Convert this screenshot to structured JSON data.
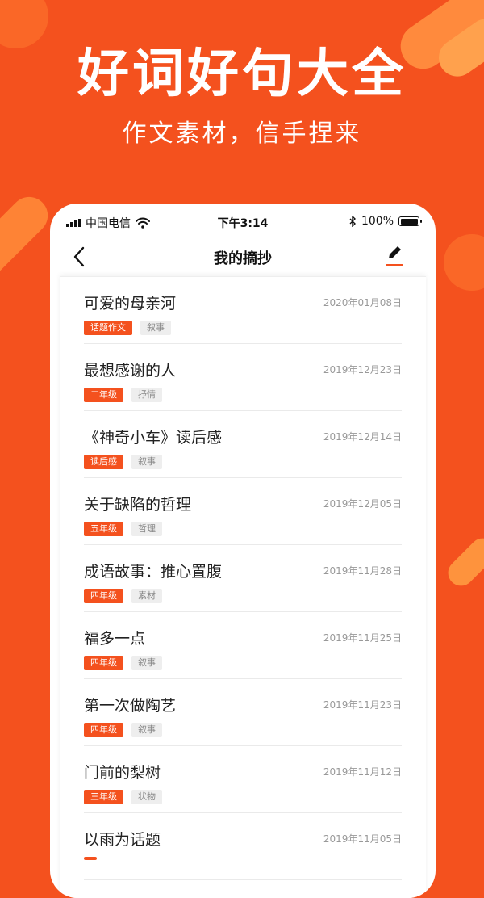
{
  "hero": {
    "title": "好词好句大全",
    "subtitle": "作文素材，信手捏来"
  },
  "status_bar": {
    "carrier": "中国电信",
    "time": "下午3:14",
    "battery": "100%"
  },
  "nav": {
    "title": "我的摘抄",
    "back_icon": "chevron-left-icon",
    "edit_icon": "pencil-icon"
  },
  "colors": {
    "accent": "#f4511e",
    "tag_secondary_bg": "#eeeeee"
  },
  "items": [
    {
      "title": "可爱的母亲河",
      "date": "2020年01月08日",
      "tag1": "话题作文",
      "tag2": "叙事"
    },
    {
      "title": "最想感谢的人",
      "date": "2019年12月23日",
      "tag1": "二年级",
      "tag2": "抒情"
    },
    {
      "title": "《神奇小车》读后感",
      "date": "2019年12月14日",
      "tag1": "读后感",
      "tag2": "叙事"
    },
    {
      "title": "关于缺陷的哲理",
      "date": "2019年12月05日",
      "tag1": "五年级",
      "tag2": "哲理"
    },
    {
      "title": "成语故事：推心置腹",
      "date": "2019年11月28日",
      "tag1": "四年级",
      "tag2": "素材"
    },
    {
      "title": "福多一点",
      "date": "2019年11月25日",
      "tag1": "四年级",
      "tag2": "叙事"
    },
    {
      "title": "第一次做陶艺",
      "date": "2019年11月23日",
      "tag1": "四年级",
      "tag2": "叙事"
    },
    {
      "title": "门前的梨树",
      "date": "2019年11月12日",
      "tag1": "三年级",
      "tag2": "状物"
    },
    {
      "title": "以雨为话题",
      "date": "2019年11月05日",
      "tag1": "",
      "tag2": ""
    }
  ]
}
